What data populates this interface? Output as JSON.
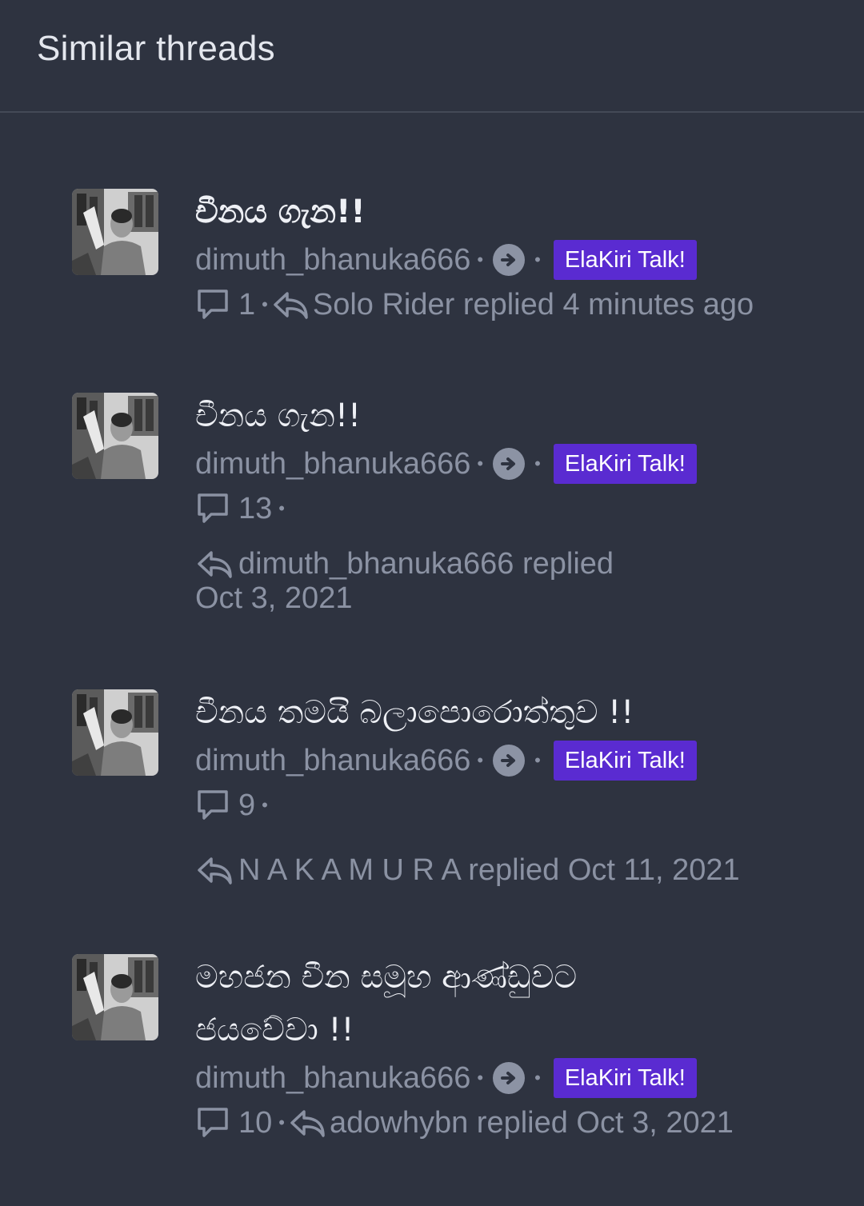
{
  "header": {
    "title": "Similar threads"
  },
  "threads": [
    {
      "title": "චීනය ගැන!!",
      "author": "dimuth_bhanuka666",
      "forum": "ElaKiri Talk!",
      "replies": "1",
      "last_reply": "Solo Rider replied 4 minutes ago"
    },
    {
      "title": "චීනය ගැන!!",
      "author": "dimuth_bhanuka666",
      "forum": "ElaKiri Talk!",
      "replies": "13",
      "last_reply_user": "dimuth_bhanuka666 replied",
      "last_reply_date": "Oct 3, 2021"
    },
    {
      "title": "චීනය තමයි බලාපොරොත්තුව !!",
      "author": "dimuth_bhanuka666",
      "forum": "ElaKiri Talk!",
      "replies": "9",
      "last_reply": "N A K A M U R A replied Oct 11, 2021"
    },
    {
      "title_line1": "මහජන චීන සමූහ ආණ්ඩුවට",
      "title_line2": "ජයවේවා !!",
      "author": "dimuth_bhanuka666",
      "forum": "ElaKiri Talk!",
      "replies": "10",
      "last_reply": "adowhybn replied Oct 3, 2021"
    }
  ],
  "icons": {
    "replies": "speech-bubble-icon",
    "last_reply": "reply-arrow-icon",
    "forum_arrow": "arrow-right-circle-icon"
  },
  "colors": {
    "background": "#2e3340",
    "badge": "#5a2bd1",
    "title": "#eef0f5",
    "muted": "#8b92a3"
  }
}
